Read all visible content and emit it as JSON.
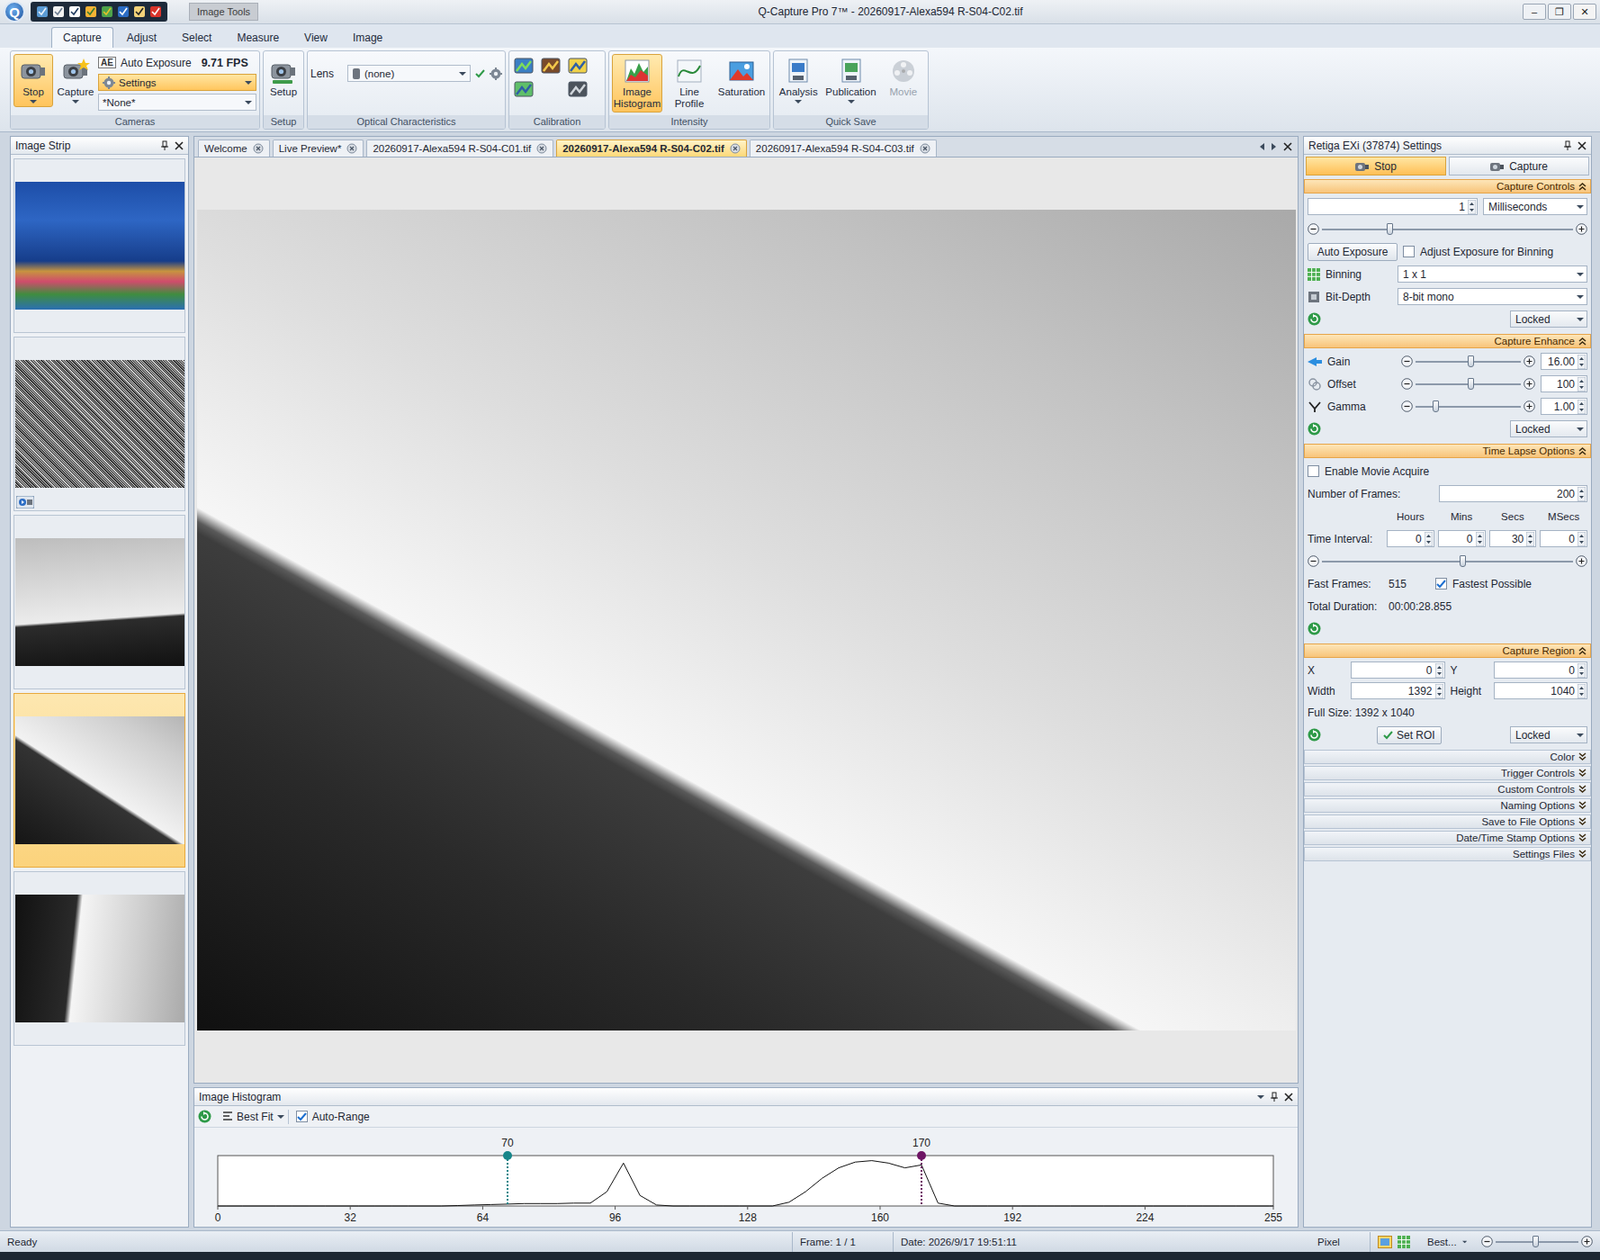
{
  "window": {
    "logo": "Q",
    "title": "Q-Capture Pro 7™ - 20260917-Alexa594 R-S04-C02.tif",
    "context_tab": "Image Tools",
    "controls": [
      "–",
      "❐",
      "✕"
    ]
  },
  "ribbon": {
    "tabs": [
      {
        "label": "Capture",
        "selected": true
      },
      {
        "label": "Adjust",
        "selected": false
      },
      {
        "label": "Select",
        "selected": false
      },
      {
        "label": "Measure",
        "selected": false
      },
      {
        "label": "View",
        "selected": false
      },
      {
        "label": "Image",
        "selected": false
      }
    ],
    "cameras": {
      "label": "Cameras",
      "buttons": [
        {
          "label": "Stop",
          "selected": true
        },
        {
          "label": "Capture",
          "selected": false
        }
      ],
      "ae_badge": "AE",
      "auto_exposure": "Auto Exposure",
      "fps": "9.71 FPS",
      "settings": "Settings",
      "preset": "*None*"
    },
    "setup": {
      "label": "Setup",
      "button": "Setup"
    },
    "optical": {
      "label": "Optical Characteristics",
      "lens_label": "Lens",
      "lens_value": "(none)"
    },
    "calibration": {
      "label": "Calibration"
    },
    "intensity": {
      "label": "Intensity",
      "buttons": [
        {
          "label": "Image Histogram",
          "selected": true
        },
        {
          "label": "Line Profile",
          "selected": false
        },
        {
          "label": "Saturation",
          "selected": false
        }
      ]
    },
    "quick_save": {
      "label": "Quick Save",
      "buttons": [
        {
          "label": "Analysis",
          "disabled": false
        },
        {
          "label": "Publication",
          "disabled": false
        },
        {
          "label": "Movie",
          "disabled": true
        }
      ]
    }
  },
  "image_strip": {
    "title": "Image Strip",
    "items": [
      {
        "kind": "logo",
        "selected": false,
        "live": false
      },
      {
        "kind": "noise",
        "selected": false,
        "live": true
      },
      {
        "kind": "slope-low",
        "selected": false,
        "live": false
      },
      {
        "kind": "slope-steep",
        "selected": true,
        "live": false
      },
      {
        "kind": "curve",
        "selected": false,
        "live": false
      }
    ]
  },
  "doc_tabs": [
    {
      "label": "Welcome",
      "selected": false
    },
    {
      "label": "Live Preview*",
      "selected": false
    },
    {
      "label": "20260917-Alexa594 R-S04-C01.tif",
      "selected": false
    },
    {
      "label": "20260917-Alexa594 R-S04-C02.tif",
      "selected": true
    },
    {
      "label": "20260917-Alexa594 R-S04-C03.tif",
      "selected": false
    }
  ],
  "histogram": {
    "title": "Image Histogram",
    "fit": "Best Fit",
    "auto_range": {
      "label": "Auto-Range",
      "checked": true
    },
    "x_ticks": [
      "0",
      "32",
      "64",
      "96",
      "128",
      "160",
      "192",
      "224",
      "255"
    ],
    "x_max": 255,
    "bin_width": 4,
    "markers": [
      {
        "label": "70",
        "value": 70,
        "color": "#17868a"
      },
      {
        "label": "170",
        "value": 170,
        "color": "#6e1565"
      }
    ],
    "values": [
      0,
      0,
      0,
      0,
      0,
      0,
      0,
      0,
      0,
      0,
      0,
      0,
      0,
      0,
      1,
      2,
      3,
      4,
      5,
      5,
      5,
      6,
      6,
      30,
      90,
      22,
      2,
      0,
      0,
      0,
      0,
      0,
      0,
      0,
      8,
      30,
      58,
      80,
      92,
      95,
      90,
      80,
      86,
      6,
      0,
      0,
      0,
      0,
      0,
      0,
      0,
      0,
      0,
      0,
      0,
      0,
      0,
      0,
      0,
      0,
      0,
      0,
      0,
      0
    ]
  },
  "settings_panel": {
    "title": "Retiga EXi (37874) Settings",
    "actions": [
      {
        "label": "Stop",
        "selected": true
      },
      {
        "label": "Capture",
        "selected": false
      }
    ],
    "capture_controls": {
      "title": "Capture Controls",
      "expanded": true,
      "exposure": "1",
      "unit": "Milliseconds",
      "level": 0.27,
      "auto_exposure": "Auto Exposure",
      "adjust_binning": {
        "label": "Adjust Exposure for Binning",
        "checked": false
      },
      "fields": [
        {
          "label": "Binning",
          "value": "1 x 1"
        },
        {
          "label": "Bit-Depth",
          "value": "8-bit mono"
        }
      ],
      "lock": "Locked"
    },
    "capture_enhance": {
      "title": "Capture Enhance",
      "expanded": true,
      "sliders": [
        {
          "label": "Gain",
          "level": 0.52,
          "value": "16.00"
        },
        {
          "label": "Offset",
          "level": 0.52,
          "value": "100"
        },
        {
          "label": "Gamma",
          "level": 0.19,
          "value": "1.00"
        }
      ],
      "lock": "Locked"
    },
    "time_lapse": {
      "title": "Time Lapse Options",
      "expanded": true,
      "enable_movie": {
        "label": "Enable Movie Acquire",
        "checked": false
      },
      "frames_label": "Number of  Frames:",
      "frames": "200",
      "interval_label": "Time Interval:",
      "interval": [
        {
          "unit": "Hours",
          "value": "0"
        },
        {
          "unit": "Mins",
          "value": "0"
        },
        {
          "unit": "Secs",
          "value": "30"
        },
        {
          "unit": "MSecs",
          "value": "0"
        }
      ],
      "level": 0.56,
      "fast_frames_label": "Fast Frames:",
      "fast_frames": "515",
      "fastest": {
        "label": "Fastest Possible",
        "checked": true
      },
      "duration_label": "Total Duration:",
      "duration": "00:00:28.855"
    },
    "capture_region": {
      "title": "Capture Region",
      "expanded": true,
      "fields": [
        {
          "label": "X",
          "value": "0"
        },
        {
          "label": "Y",
          "value": "0"
        },
        {
          "label": "Width",
          "value": "1392"
        },
        {
          "label": "Height",
          "value": "1040"
        }
      ],
      "full_size": "Full Size: 1392 x 1040",
      "set_roi": "Set ROI",
      "lock": "Locked"
    },
    "collapsed": [
      {
        "title": "Color",
        "expanded": false
      },
      {
        "title": "Trigger Controls",
        "expanded": false
      },
      {
        "title": "Custom Controls",
        "expanded": false
      },
      {
        "title": "Naming Options",
        "expanded": false
      },
      {
        "title": "Save to File Options",
        "expanded": false
      },
      {
        "title": "Date/Time Stamp Options",
        "expanded": false
      },
      {
        "title": "Settings Files",
        "expanded": false
      }
    ]
  },
  "status_bar": {
    "status": "Ready",
    "frame": "Frame: 1 / 1",
    "date": "Date: 2026/9/17 19:51:11",
    "unit": "Pixel",
    "zoom": "Best...",
    "zoom_level": 0.48
  }
}
